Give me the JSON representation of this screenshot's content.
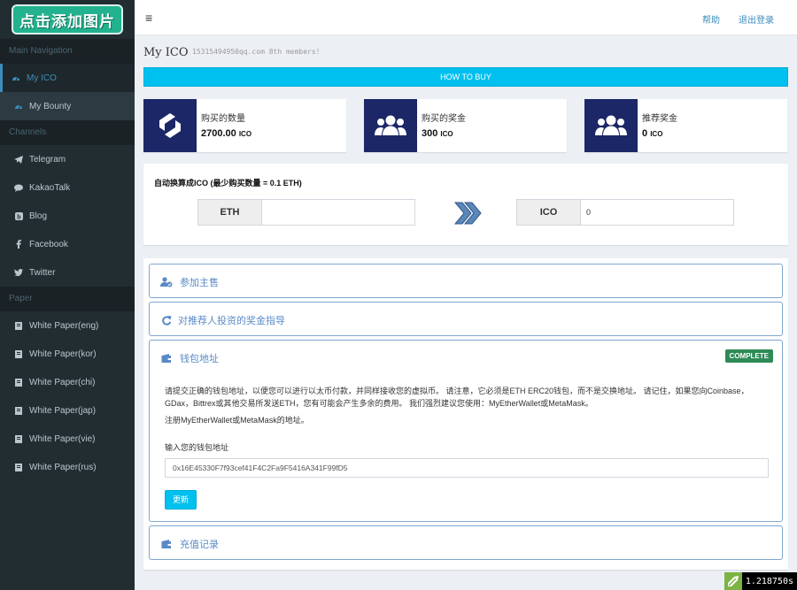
{
  "logo": {
    "label": "点击添加图片"
  },
  "sidebar": {
    "sections": [
      {
        "header": "Main Navigation",
        "items": [
          {
            "label": "My ICO",
            "icon": "dashboard-icon",
            "active": true
          },
          {
            "label": "My Bounty",
            "icon": "dashboard-icon",
            "active": false
          }
        ]
      },
      {
        "header": "Channels",
        "items": [
          {
            "label": "Telegram",
            "icon": "telegram-icon"
          },
          {
            "label": "KakaoTalk",
            "icon": "chat-icon"
          },
          {
            "label": "Blog",
            "icon": "blog-icon"
          },
          {
            "label": "Facebook",
            "icon": "facebook-icon"
          },
          {
            "label": "Twitter",
            "icon": "twitter-icon"
          }
        ]
      },
      {
        "header": "Paper",
        "items": [
          {
            "label": "White Paper(eng)",
            "icon": "document-icon"
          },
          {
            "label": "White Paper(kor)",
            "icon": "document-icon"
          },
          {
            "label": "White Paper(chi)",
            "icon": "document-icon"
          },
          {
            "label": "White Paper(jap)",
            "icon": "document-icon"
          },
          {
            "label": "White Paper(vie)",
            "icon": "document-icon"
          },
          {
            "label": "White Paper(rus)",
            "icon": "document-icon"
          }
        ]
      }
    ]
  },
  "header": {
    "menu_icon": "≡",
    "help": "帮助",
    "logout": "退出登录"
  },
  "page": {
    "title": "My ICO",
    "subtitle": "15315494950qq.com 8th members!",
    "howto_button": "HOW TO BUY"
  },
  "stats": [
    {
      "label": "购买的数量",
      "value": "2700.00",
      "unit": "ICO",
      "icon": "exchange-icon"
    },
    {
      "label": "购买的奖金",
      "value": "300",
      "unit": "ICO",
      "icon": "users-icon"
    },
    {
      "label": "推荐奖金",
      "value": "0",
      "unit": "ICO",
      "icon": "users-icon"
    }
  ],
  "convert": {
    "title": "自动换算成ICO (最少购买数量 = 0.1 ETH)",
    "from_label": "ETH",
    "from_value": "",
    "to_label": "ICO",
    "to_value": "0"
  },
  "accordion": {
    "panels": [
      {
        "title": "参加主售",
        "icon": "user-check-icon"
      },
      {
        "title": "对推荐人投资的奖金指导",
        "icon": "refresh-icon"
      },
      {
        "title": "钱包地址",
        "icon": "wallet-icon",
        "badge": "COMPLETE"
      },
      {
        "title": "充值记录",
        "icon": "wallet-icon"
      }
    ],
    "wallet": {
      "desc_line1": "请提交正确的钱包地址，以便您可以进行以太币付款，并同样接收您的虚拟币。 请注意，它必须是ETH ERC20钱包，而不是交换地址。 请记住，如果您向Coinbase，",
      "desc_line2": "GDax，Bittrex或其他交易所发送ETH，您有可能会产生多余的费用。 我们强烈建议您使用：MyEtherWallet或MetaMask。",
      "note": "注册MyEtherWallet或MetaMask的地址。",
      "input_label": "输入您的钱包地址",
      "input_value": "0x16E45330F7f93cef41F4C2Fa9F5416A341F99fD5",
      "update_button": "更新"
    }
  },
  "timer": {
    "value": "1.218750s"
  },
  "colors": {
    "sidebar_bg": "#222d32",
    "accent": "#00c0ef",
    "stat_icon_bg": "#1b2767",
    "complete": "#2e8b57"
  }
}
